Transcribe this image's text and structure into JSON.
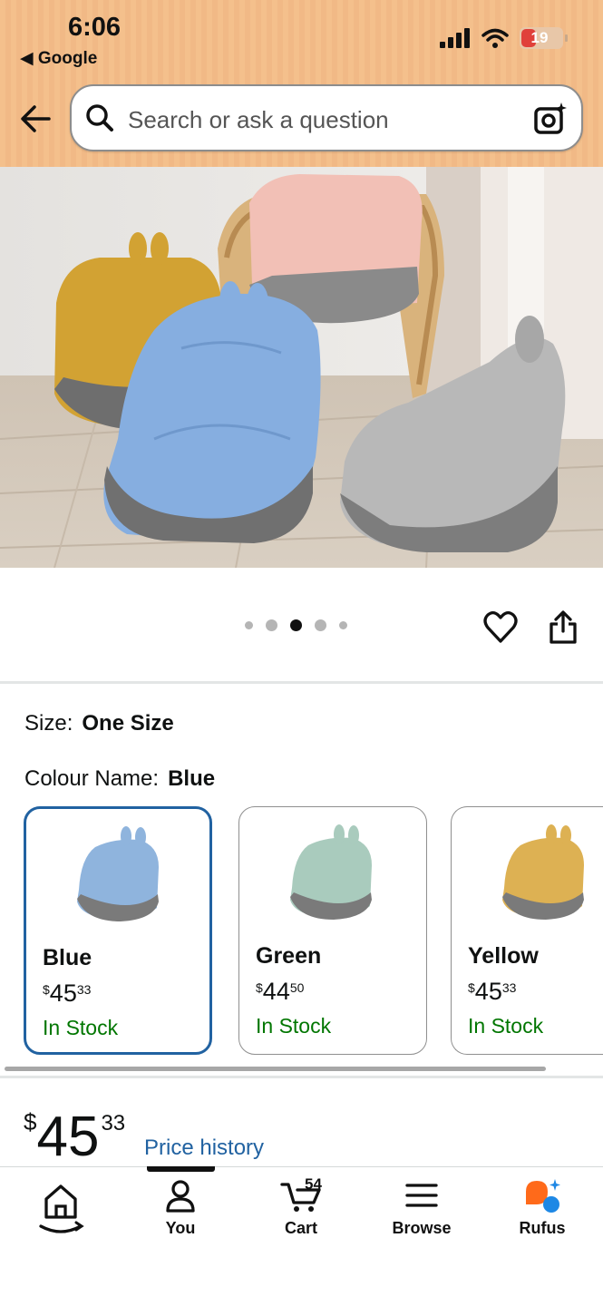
{
  "status_bar": {
    "time": "6:06",
    "back_app": "Google",
    "battery": "19"
  },
  "search": {
    "placeholder": "Search or ask a question"
  },
  "gallery": {
    "image_count": 5,
    "active_index": 2
  },
  "variations": {
    "size_label": "Size:",
    "size_value": "One Size",
    "colour_label": "Colour Name:",
    "colour_value": "Blue",
    "swatches": [
      {
        "name": "Blue",
        "currency": "$",
        "price_whole": "45",
        "price_cents": "33",
        "stock": "In Stock",
        "color": "#8fb4dd",
        "selected": true
      },
      {
        "name": "Green",
        "currency": "$",
        "price_whole": "44",
        "price_cents": "50",
        "stock": "In Stock",
        "color": "#a9cbbd",
        "selected": false
      },
      {
        "name": "Yellow",
        "currency": "$",
        "price_whole": "45",
        "price_cents": "33",
        "stock": "In Stock",
        "color": "#ddb153",
        "selected": false
      }
    ]
  },
  "price": {
    "currency": "$",
    "whole": "45",
    "cents": "33",
    "history_link": "Price history"
  },
  "bottom_nav": {
    "items": [
      {
        "label": "",
        "icon": "home-icon"
      },
      {
        "label": "You",
        "icon": "person-icon"
      },
      {
        "label": "Cart",
        "icon": "cart-icon",
        "count": "54"
      },
      {
        "label": "Browse",
        "icon": "menu-icon"
      },
      {
        "label": "Rufus",
        "icon": "rufus-icon"
      }
    ]
  },
  "colors": {
    "link": "#2162a1",
    "in_stock": "#007600",
    "header": "#f4c08c",
    "selected_border": "#2162a1"
  }
}
